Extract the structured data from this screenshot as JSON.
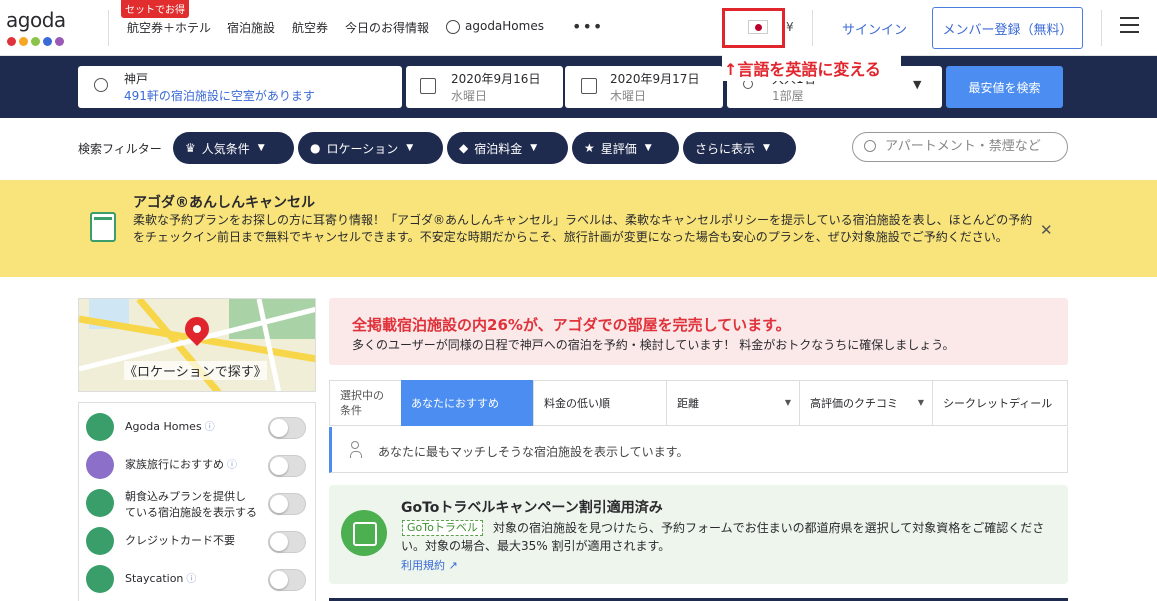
{
  "brand": {
    "name": "agoda",
    "dot_colors": [
      "#e0323a",
      "#f5a623",
      "#8bc34a",
      "#3a6ad6",
      "#9b59b6"
    ]
  },
  "nav": {
    "badge": "セットでお得",
    "items": [
      "航空券＋ホテル",
      "宿泊施設",
      "航空券",
      "今日のお得情報",
      "agodaHomes"
    ],
    "more": "•••",
    "currency": "¥",
    "signin": "サインイン",
    "register": "メンバー登録（無料）"
  },
  "annotation": "↑言語を英語に変える",
  "search": {
    "destination": "神戸",
    "availability": "491軒の宿泊施設に空室があります",
    "checkin_date": "2020年9月16日",
    "checkin_day": "水曜日",
    "checkout_date": "2020年9月17日",
    "checkout_day": "木曜日",
    "guests": "大人1名",
    "rooms": "1部屋",
    "button": "最安値を検索"
  },
  "filters": {
    "label": "検索フィルター",
    "pills": [
      "人気条件",
      "ロケーション",
      "宿泊料金",
      "星評価",
      "さらに表示"
    ],
    "search_placeholder": "アパートメント・禁煙など"
  },
  "banner": {
    "title": "アゴダ®あんしんキャンセル",
    "text": "柔軟な予約プランをお探しの方に耳寄り情報！「アゴダ®あんしんキャンセル」ラベルは、柔軟なキャンセルポリシーを提示している宿泊施設を表し、ほとんどの予約をチェックイン前日まで無料でキャンセルできます。不安定な時期だからこそ、旅行計画が変更になった場合も安心のプランを、ぜひ対象施設でご予約ください。",
    "close": "✕"
  },
  "map": {
    "label": "《ロケーションで探す》"
  },
  "side_filters": [
    {
      "label": "Agoda Homes",
      "info": "ⓘ",
      "color": "#3a9e6b"
    },
    {
      "label": "家族旅行におすすめ",
      "info": "ⓘ",
      "color": "#8b6fc9"
    },
    {
      "label": "朝食込みプランを提供している宿泊施設を表示する",
      "label_line1": "朝食込みプランを提供し",
      "label_line2": "ている宿泊施設を表示する",
      "info": "",
      "color": "#3a9e6b"
    },
    {
      "label": "クレジットカード不要",
      "info": "",
      "color": "#3a9e6b"
    },
    {
      "label": "Staycation",
      "info": "ⓘ",
      "color": "#3a9e6b"
    }
  ],
  "alert": {
    "title": "全掲載宿泊施設の内26%が、アゴダでの部屋を完売しています。",
    "text": "多くのユーザーが同様の日程で神戸への宿泊を予約・検討しています！ 料金がおトクなうちに確保しましょう。"
  },
  "sort": {
    "first_line1": "選択中の",
    "first_line2": "条件",
    "options": [
      "あなたにおすすめ",
      "料金の低い順",
      "距離",
      "高評価のクチコミ",
      "シークレットディール"
    ]
  },
  "match_text": "あなたに最もマッチしそうな宿泊施設を表示しています。",
  "goto": {
    "title": "GoToトラベルキャンペーン割引適用済み",
    "tag": "GoToトラベル",
    "text": "対象の宿泊施設を見つけたら、予約フォームでお住まいの都道府県を選択して対象資格をご確認ください。対象の場合、最大35% 割引が適用されます。",
    "link": "利用規約 ↗"
  }
}
